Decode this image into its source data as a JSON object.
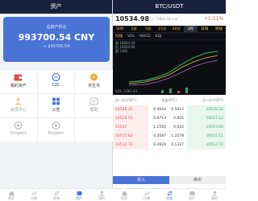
{
  "left": {
    "header_title": "资产",
    "assets_label": "总资产折合",
    "assets_value": "993700.54 CNY",
    "assets_sub": "≈ $55700.54",
    "grid": [
      [
        {
          "label": "我的资产",
          "icon": "wallet-icon",
          "dim": false
        },
        {
          "label": "C2C",
          "icon": "c2c-icon",
          "dim": false
        },
        {
          "label": "币生币",
          "icon": "coin-icon",
          "dim": false
        }
      ],
      [
        {
          "label": "会员中心",
          "icon": "user-icon",
          "dim": true
        },
        {
          "label": "公告",
          "icon": "apps-icon",
          "dim": false
        },
        {
          "label": "帮助",
          "icon": "help-icon",
          "dim": true
        }
      ],
      [
        {
          "label": "Exspect",
          "icon": "expect-icon",
          "dim": true
        },
        {
          "label": "Exspect",
          "icon": "expect-icon",
          "dim": true
        },
        {
          "label": "",
          "icon": "",
          "dim": true
        }
      ]
    ]
  },
  "right": {
    "header_title": "BTC/USDT",
    "price": "10534.98",
    "subprice": "≈ 73881.18 cny",
    "change": "+1.21%",
    "timeframes": [
      "分时",
      "1分",
      "5分",
      "15分",
      "30分",
      "1时",
      "日线",
      "周线"
    ],
    "active_tf": "1时",
    "indicators": {
      "ma": "均线",
      "vol": "VOL",
      "macd": "MACD",
      "kdj": "KDJ"
    },
    "chart_info": [
      "高 10600.34",
      "低 10450.90",
      "量 1365"
    ],
    "vol_label": "VOL: 1365.43",
    "ob_headers": [
      "卖一价(USDT)",
      "数量(BTC)",
      "买一价(USDT)"
    ],
    "orderbook": [
      {
        "ask": "10528.32",
        "q1": "0.4644",
        "q2": "0.5612",
        "bid": "10528.32"
      },
      {
        "ask": "10529.55",
        "q1": "0.8713",
        "q2": "0.925",
        "bid": "10527.12"
      },
      {
        "ask": "10517",
        "q1": "1.1550",
        "q2": "0.622",
        "bid": "10515.00"
      },
      {
        "ask": "10515.82",
        "q1": "0.3587",
        "q2": "1.2278",
        "bid": "10515.11"
      },
      {
        "ask": "10514.72",
        "q1": "0.2929",
        "q2": "0.1327",
        "bid": "10512.72"
      }
    ],
    "buy_label": "买入",
    "sell_label": "卖出"
  },
  "tabs": [
    "首页",
    "行情",
    "交易",
    "资产",
    "我的"
  ],
  "colors": {
    "accent": "#4a73d6",
    "header": "#17213c",
    "red": "#e34b4b",
    "green": "#2fa56b"
  }
}
